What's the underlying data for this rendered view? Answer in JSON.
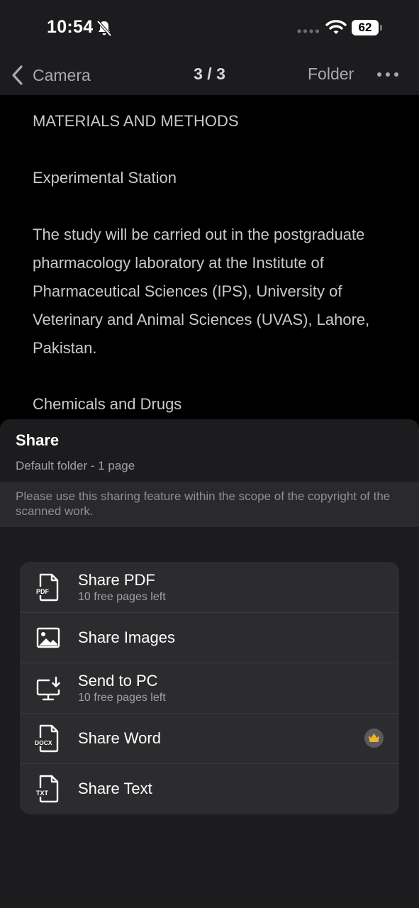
{
  "status_bar": {
    "time": "10:54",
    "battery": "62"
  },
  "nav": {
    "back_label": "Camera",
    "page_indicator": "3 / 3",
    "folder_label": "Folder"
  },
  "document": {
    "paragraphs": [
      "MATERIALS AND METHODS",
      "Experimental Station",
      "The study will be carried out in the postgraduate pharmacology laboratory at the Institute of Pharmaceutical Sciences (IPS), University of Veterinary and Animal Sciences (UVAS), Lahore, Pakistan.",
      "Chemicals and Drugs"
    ]
  },
  "share_sheet": {
    "title": "Share",
    "subtitle": "Default folder - 1 page",
    "notice": "Please use this sharing feature within the scope of the copyright of the scanned work.",
    "options": [
      {
        "label": "Share PDF",
        "note": "10 free pages left",
        "icon": "pdf-file-icon"
      },
      {
        "label": "Share Images",
        "note": "",
        "icon": "image-icon"
      },
      {
        "label": "Send to PC",
        "note": "10 free pages left",
        "icon": "monitor-download-icon"
      },
      {
        "label": "Share Word",
        "note": "",
        "icon": "docx-file-icon",
        "premium": true
      },
      {
        "label": "Share Text",
        "note": "",
        "icon": "txt-file-icon"
      }
    ],
    "premium_color": "#f0b429"
  }
}
